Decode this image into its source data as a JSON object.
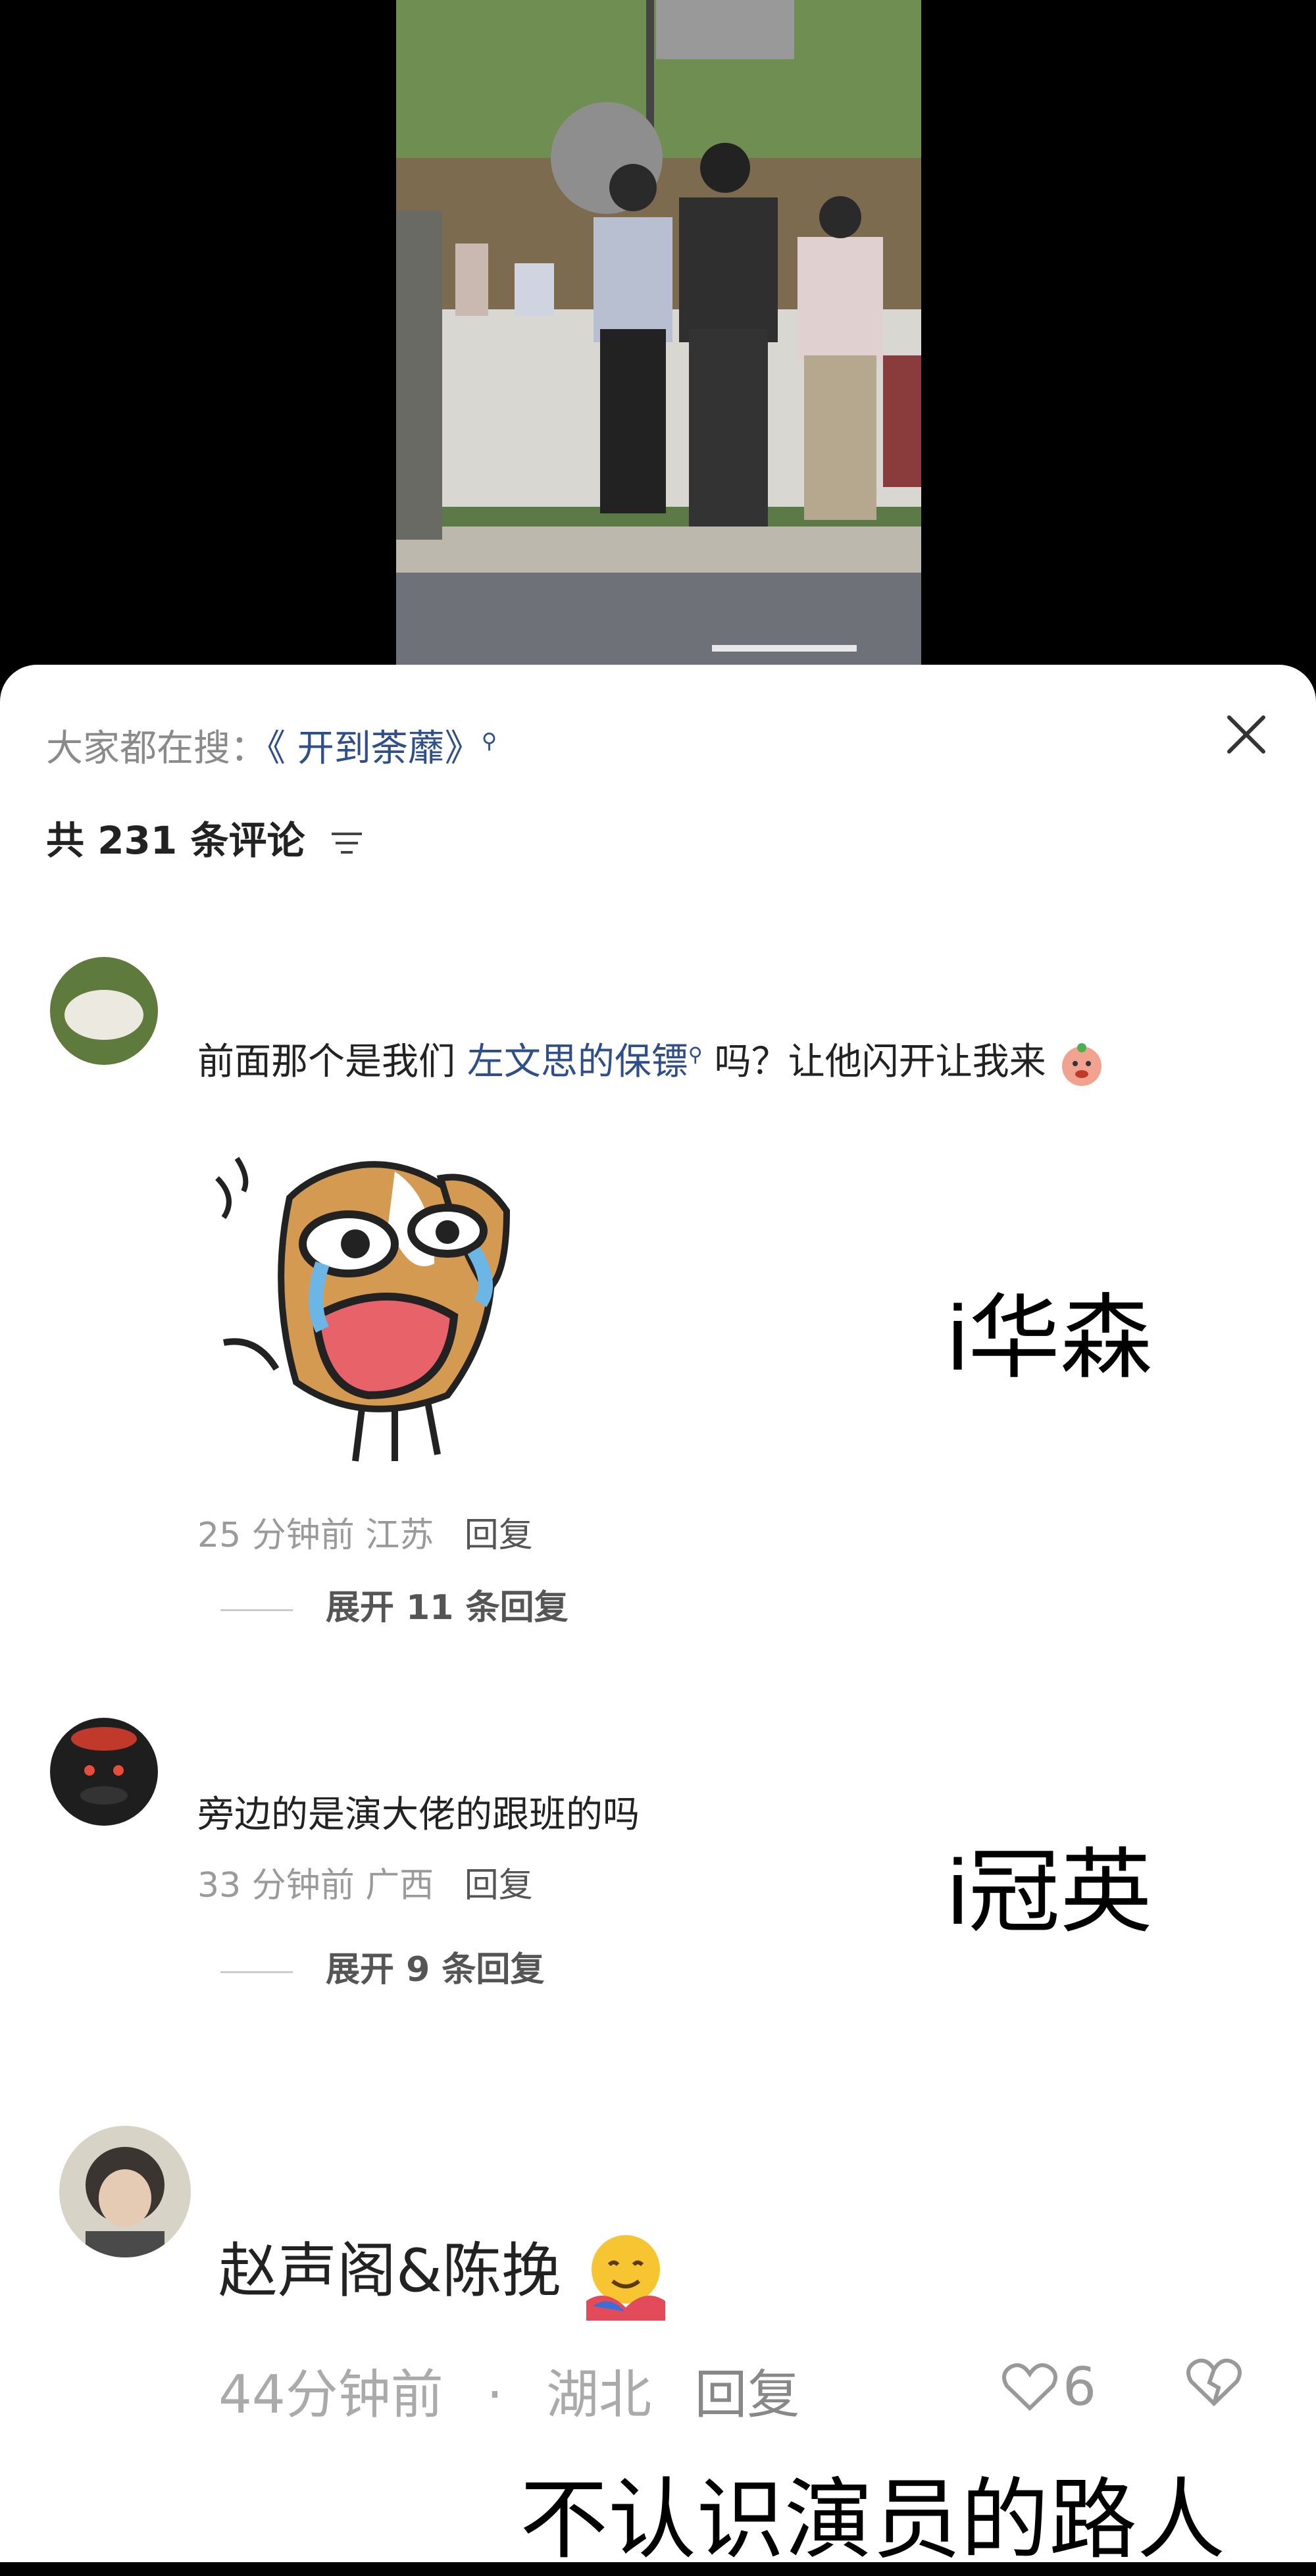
{
  "header": {
    "search_prefix": "大家都在搜：",
    "search_keyword": "《 开到荼蘼》",
    "comment_count_label": "共 231 条评论"
  },
  "comments": [
    {
      "text_before": "前面那个是我们 ",
      "text_link": "左文思的保镖",
      "text_after": " 吗？让他闪开让我来",
      "time": "25 分钟前",
      "location": "江苏",
      "reply_label": "回复",
      "expand_label": "展开 11 条回复",
      "overlay": "i华森"
    },
    {
      "text": "旁边的是演大佬的跟班的吗",
      "time": "33 分钟前",
      "location": "广西",
      "reply_label": "回复",
      "expand_label": "展开 9 条回复",
      "overlay": "i冠英"
    },
    {
      "text": "赵声阁&陈挽",
      "time": "44分钟前",
      "dot": "·",
      "location": "湖北",
      "reply_label": "回复",
      "likes": "6"
    }
  ],
  "caption": "不认识演员的路人",
  "icons": [
    "search-icon",
    "close-icon",
    "filter-icon",
    "heart-icon",
    "broken-heart-icon",
    "emoji-icon",
    "hug-emoji-icon"
  ]
}
